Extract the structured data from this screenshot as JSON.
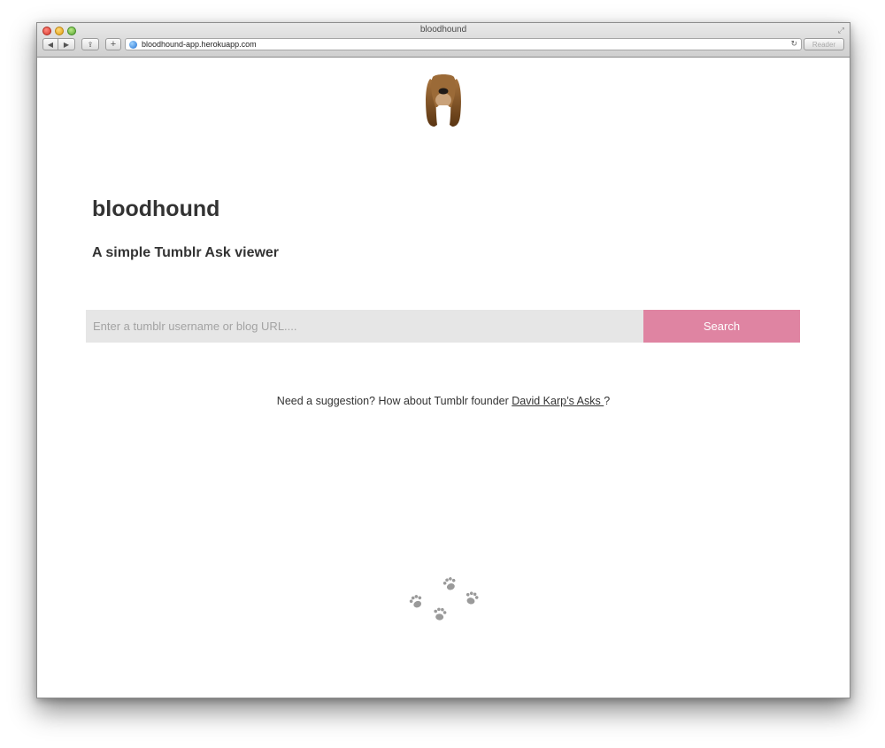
{
  "browser": {
    "window_title": "bloodhound",
    "url": "bloodhound-app.herokuapp.com",
    "reader_label": "Reader",
    "back_glyph": "◀",
    "forward_glyph": "▶",
    "share_glyph": "⇪",
    "add_glyph": "+",
    "reload_glyph": "↻",
    "fullscreen_glyph": "⤢"
  },
  "page": {
    "logo_icon": "bloodhound-dog-icon",
    "title": "bloodhound",
    "tagline": "A simple Tumblr Ask viewer",
    "search": {
      "placeholder": "Enter a tumblr username or blog URL....",
      "value": "",
      "button_label": "Search"
    },
    "suggestion": {
      "prefix": "Need a suggestion? How about Tumblr founder ",
      "link_text": "David Karp’s Asks ",
      "suffix": "?"
    },
    "footer_icon": "paw-prints-icon"
  },
  "colors": {
    "accent": "#df84a2",
    "input_bg": "#e6e6e6",
    "text": "#333333",
    "paw": "#9a9a9a",
    "dog_brown": "#8a5a2b"
  }
}
